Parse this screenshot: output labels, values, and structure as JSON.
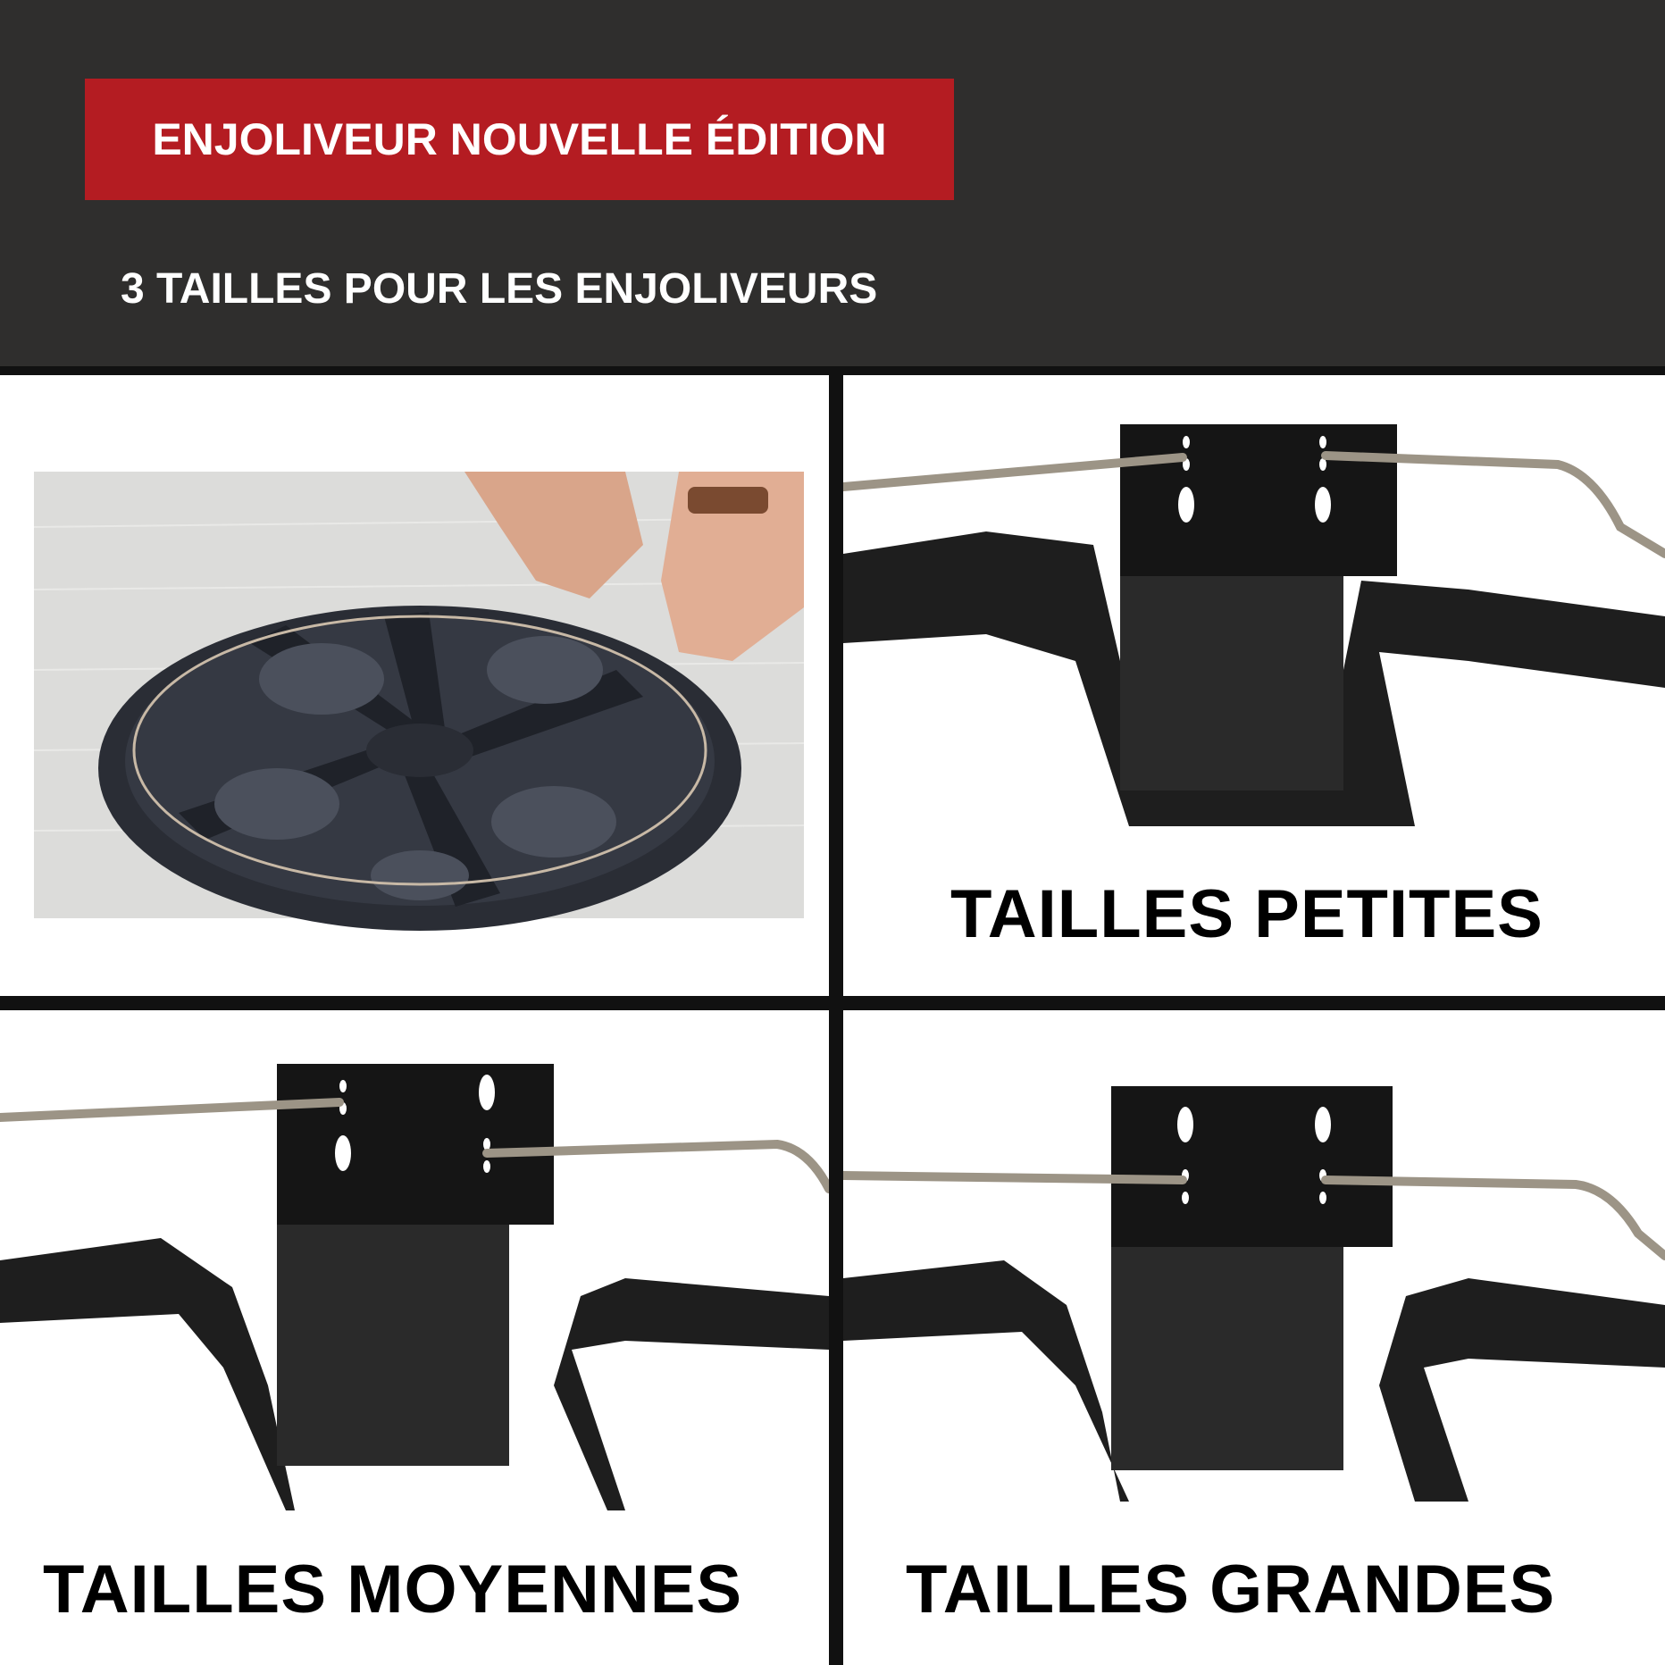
{
  "header": {
    "badge_text": "ENJOLIVEUR NOUVELLE ÉDITION",
    "subtitle": "3 TAILLES POUR LES ENJOLIVEURS",
    "background_color": "#2f2e2d",
    "badge_color": "#b41c22"
  },
  "panels": [
    {
      "id": "installation-photo",
      "label": ""
    },
    {
      "id": "small",
      "label": "TAILLES PETITES"
    },
    {
      "id": "medium",
      "label": "TAILLES MOYENNES"
    },
    {
      "id": "large",
      "label": "TAILLES GRANDES"
    }
  ]
}
